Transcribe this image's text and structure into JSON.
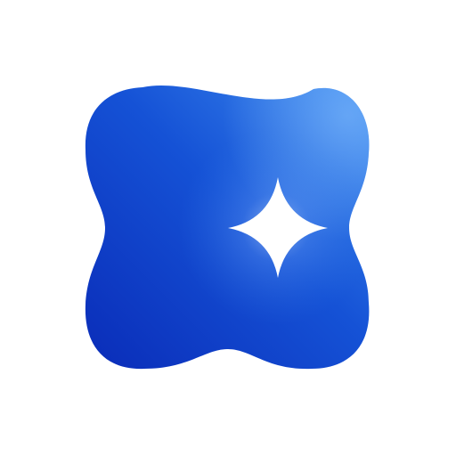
{
  "icon": {
    "name": "sparkle-app-icon",
    "shape": "squircle-blob",
    "glyph": "four-point-sparkle",
    "colors": {
      "background": "#ffffff",
      "blob_dark": "#0A2CB8",
      "blob_mid": "#1552D6",
      "blob_light": "#3D8BEF",
      "sparkle": "#ffffff"
    }
  }
}
